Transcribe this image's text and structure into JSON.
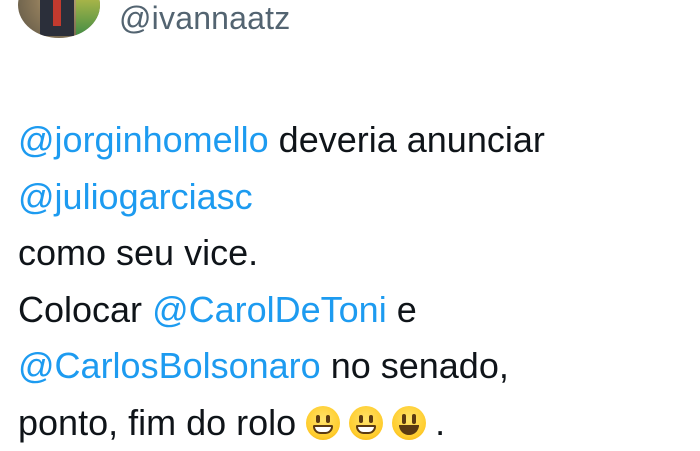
{
  "profile": {
    "handle": "@ivannaatz"
  },
  "tweet": {
    "mention_1": "@jorginhomello",
    "text_1": " deveria anunciar",
    "mention_2": "@juliogarciasc",
    "text_2": "como seu vice.",
    "text_3": "Colocar ",
    "mention_3": "@CarolDeToni",
    "text_4": " e",
    "mention_4": "@CarlosBolsonaro",
    "text_5": " no senado,",
    "text_6": "ponto, fim do rolo ",
    "text_7": "."
  },
  "emojis": [
    "grinning-face-with-smiling-eyes",
    "grinning-face-with-smiling-eyes",
    "smiling-face-with-open-mouth"
  ],
  "colors": {
    "mention": "#1d9bf0",
    "text": "#0f1419",
    "handle": "#536471"
  }
}
